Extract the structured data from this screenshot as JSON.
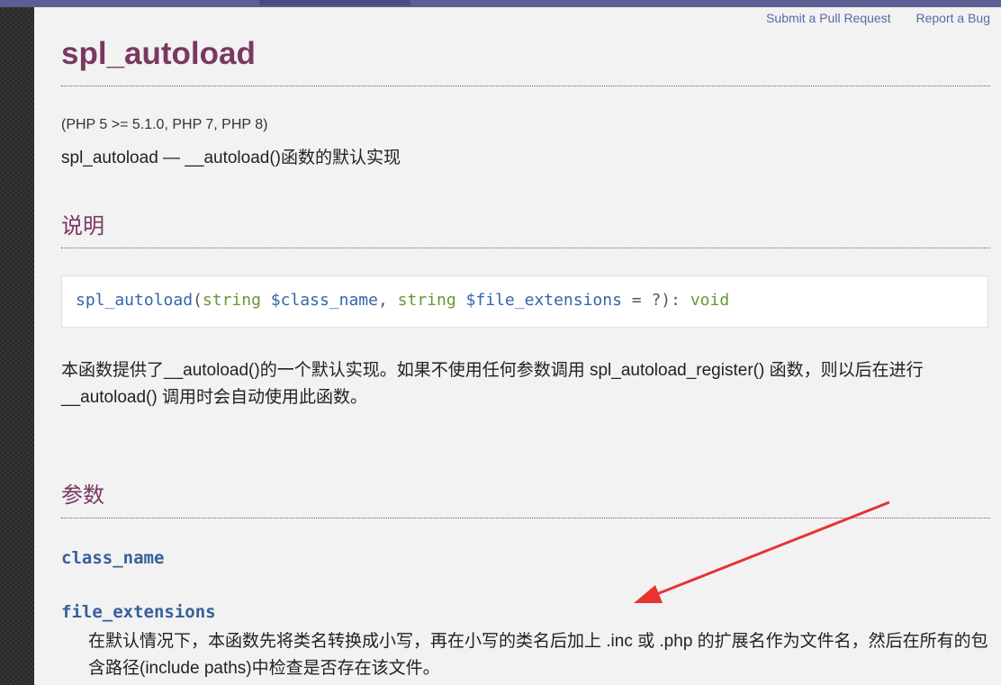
{
  "top_links": {
    "pull_request": "Submit a Pull Request",
    "report_bug": "Report a Bug"
  },
  "title": "spl_autoload",
  "version": "(PHP 5 >= 5.1.0, PHP 7, PHP 8)",
  "refpurpose": "spl_autoload — __autoload()函数的默认实现",
  "sections": {
    "description": "说明",
    "parameters": "参数"
  },
  "signature": {
    "function": "spl_autoload",
    "open": "(",
    "type1": "string",
    "param1": "$class_name",
    "comma": ", ",
    "type2": "string",
    "param2": "$file_extensions",
    "default": " = ?",
    "close": "): ",
    "return_type": "void"
  },
  "description_text": "本函数提供了__autoload()的一个默认实现。如果不使用任何参数调用 spl_autoload_register() 函数，则以后在进行 __autoload() 调用时会自动使用此函数。",
  "params": [
    {
      "name": "class_name"
    },
    {
      "name": "file_extensions",
      "description": "在默认情况下，本函数先将类名转换成小写，再在小写的类名后加上 .inc 或 .php 的扩展名作为文件名，然后在所有的包含路径(include paths)中检查是否存在该文件。"
    }
  ],
  "colors": {
    "heading": "#793862",
    "link": "#5a6aa0",
    "param": "#36609a",
    "annotation_arrow": "#e8332f"
  }
}
